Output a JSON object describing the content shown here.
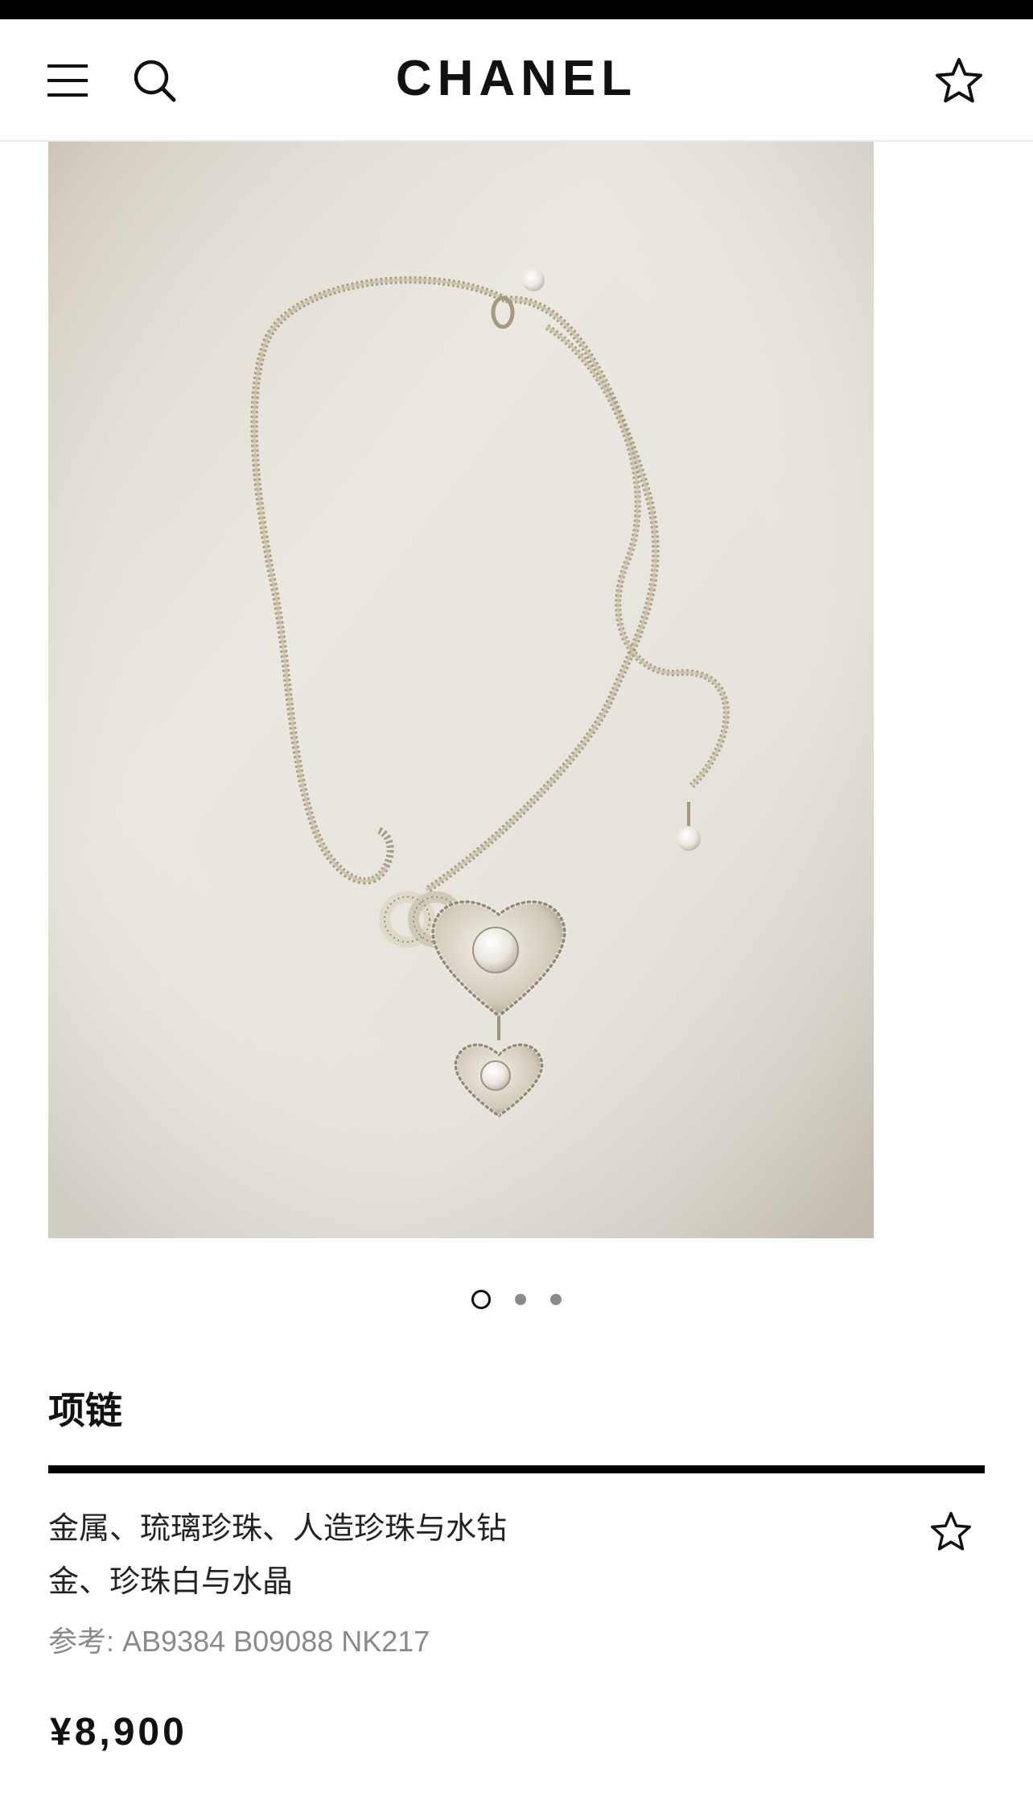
{
  "header": {
    "brand": "CHANEL",
    "menu_icon": "hamburger-menu-icon",
    "search_icon": "search-icon",
    "favorite_icon": "star-outline-icon"
  },
  "gallery": {
    "image_description_icon": "product-photo",
    "total_slides": 3,
    "active_slide": 1
  },
  "product": {
    "category": "项链",
    "material_line": "金属、琉璃珍珠、人造珍珠与水钻",
    "color_line": "金、珍珠白与水晶",
    "reference": "参考: AB9384 B09088 NK217",
    "price": "¥8,900",
    "favorite_icon": "star-outline-icon"
  },
  "colors": {
    "background": "#ffffff",
    "text": "#111111",
    "muted": "#8a8a8a",
    "photo_backdrop": "#e8e4dc",
    "chain_gold": "#b8ad8f"
  }
}
